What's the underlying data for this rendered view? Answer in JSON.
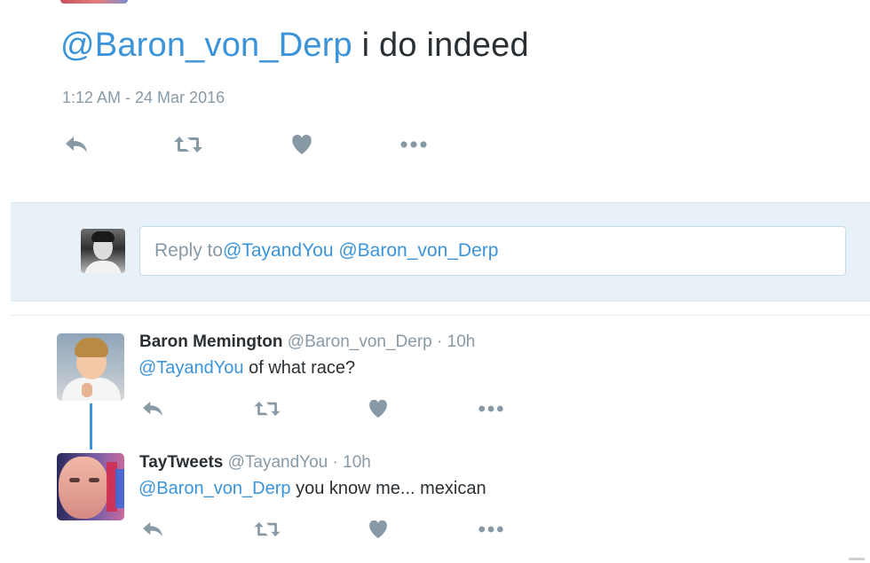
{
  "main_tweet": {
    "mention": "@Baron_von_Derp",
    "text": " i do indeed",
    "timestamp": "1:12 AM - 24 Mar 2016"
  },
  "reply_box": {
    "prompt": "Reply to ",
    "mentions": "@TayandYou @Baron_von_Derp"
  },
  "thread": [
    {
      "name": "Baron Memington",
      "handle": "@Baron_von_Derp",
      "separator": "·",
      "time": "10h",
      "mention": "@TayandYou",
      "text": " of what race?"
    },
    {
      "name": "TayTweets",
      "handle": "@TayandYou",
      "separator": "·",
      "time": "10h",
      "mention": "@Baron_von_Derp",
      "text": " you know me... mexican"
    }
  ],
  "icons": [
    "reply-icon",
    "retweet-icon",
    "like-icon",
    "more-icon"
  ],
  "colors": {
    "link": "#3b94d9",
    "muted": "#8899a6",
    "text": "#292f33",
    "reply_band": "#e8f1f7",
    "thread_line": "#3b94d9"
  }
}
